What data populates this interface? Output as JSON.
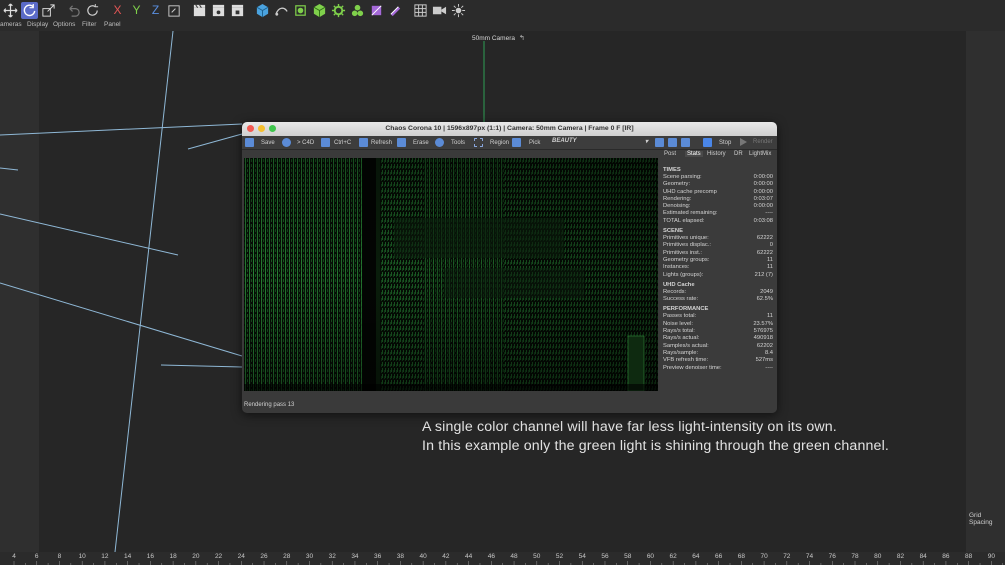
{
  "toolbar": {
    "icons": [
      "move-icon",
      "rotate-icon",
      "scale-icon",
      "undo-icon",
      "redo-icon",
      "x-axis-icon",
      "y-axis-icon",
      "z-axis-icon",
      "coordinate-icon",
      "clapper-icon",
      "clapper-settings-icon",
      "render-settings-icon",
      "cube-icon",
      "pen-icon",
      "subdivision-icon",
      "extrude-icon",
      "cloner-icon",
      "mograph-icon",
      "deformer-icon",
      "field-icon",
      "grid-icon",
      "camera-icon",
      "light-icon"
    ],
    "x_label": "X",
    "y_label": "Y",
    "z_label": "Z"
  },
  "menubar": {
    "items": [
      "ameras",
      "Display",
      "Options",
      "Filter",
      "Panel"
    ]
  },
  "viewport": {
    "camera_label": "50mm Camera",
    "camera_icon": "↰",
    "grid_spacing": "Grid Spacing"
  },
  "caption": {
    "line1": "A single color channel will have far less light-intensity on its own.",
    "line2": "In this example only the green light is shining through the green channel."
  },
  "ruler": {
    "ticks": [
      "4",
      "6",
      "8",
      "10",
      "12",
      "14",
      "16",
      "18",
      "20",
      "22",
      "24",
      "26",
      "28",
      "30",
      "32",
      "34",
      "36",
      "38",
      "40",
      "42",
      "44",
      "46",
      "48",
      "50",
      "52",
      "54",
      "56",
      "58",
      "60",
      "62",
      "64",
      "66",
      "68",
      "70",
      "72",
      "74",
      "76",
      "78",
      "80",
      "82",
      "84",
      "86",
      "88",
      "90"
    ]
  },
  "vfb": {
    "title": "Chaos Corona 10 | 1596x897px (1:1) | Camera: 50mm Camera | Frame 0 F [IR]",
    "tools": {
      "save": "Save",
      "to_c4d": "> C4D",
      "ctrl_c": "Ctrl+C",
      "refresh": "Refresh",
      "erase": "Erase",
      "tools": "Tools",
      "region": "Region",
      "pick": "Pick",
      "channel": "BEAUTY",
      "stop": "Stop",
      "render": "Render"
    },
    "tabs": [
      "Post",
      "Stats",
      "History",
      "DR",
      "LightMix"
    ],
    "status": "Rendering pass 13",
    "stats": {
      "times": {
        "title": "TIMES",
        "rows": [
          [
            "Scene parsing:",
            "0:00:00"
          ],
          [
            "Geometry:",
            "0:00:00"
          ],
          [
            "UHD cache precomp",
            "0:00:00"
          ],
          [
            "Rendering:",
            "0:03:07"
          ],
          [
            "Denoising:",
            "0:00:00"
          ],
          [
            "Estimated remaining:",
            "----"
          ],
          [
            "TOTAL elapsed:",
            "0:03:08"
          ]
        ]
      },
      "scene": {
        "title": "SCENE",
        "rows": [
          [
            "Primitives unique:",
            "62222"
          ],
          [
            "Primitives displac.:",
            "0"
          ],
          [
            "Primitives inst.:",
            "62222"
          ],
          [
            "Geometry groups:",
            "11"
          ],
          [
            "Instances:",
            "11"
          ],
          [
            "Lights (groups):",
            "212 (7)"
          ]
        ]
      },
      "uhd": {
        "title": "UHD Cache",
        "rows": [
          [
            "Records:",
            "2049"
          ],
          [
            "Success rate:",
            "62.5%"
          ]
        ]
      },
      "performance": {
        "title": "PERFORMANCE",
        "rows": [
          [
            "Passes total:",
            "11"
          ],
          [
            "Noise level:",
            "23.57%"
          ],
          [
            "Rays/s total:",
            "576975"
          ],
          [
            "Rays/s actual:",
            "490918"
          ],
          [
            "Samples/s actual:",
            "62202"
          ],
          [
            "Rays/sample:",
            "8.4"
          ],
          [
            "VFB refresh time:",
            "527ms"
          ],
          [
            "Preview denoiser time:",
            "----"
          ]
        ]
      }
    }
  },
  "colors": {
    "accent": "#5b6bc8",
    "render_green": "#3cff6a",
    "viewport_line": "#9fc7e6",
    "green_axis": "#2f9e54"
  }
}
